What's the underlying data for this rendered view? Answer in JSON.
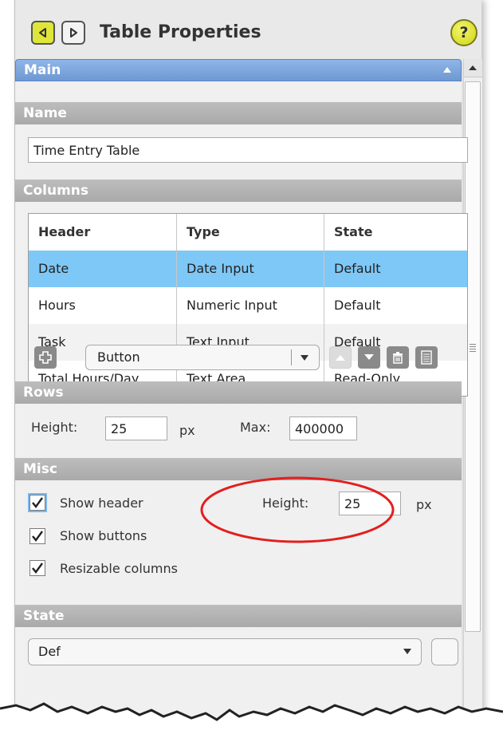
{
  "header": {
    "title": "Table Properties",
    "help_label": "?"
  },
  "main_section": {
    "label": "Main"
  },
  "name_section": {
    "label": "Name",
    "value": "Time Entry Table"
  },
  "columns_section": {
    "label": "Columns",
    "headers": [
      "Header",
      "Type",
      "State"
    ],
    "rows": [
      [
        "Date",
        "Date Input",
        "Default"
      ],
      [
        "Hours",
        "Numeric Input",
        "Default"
      ],
      [
        "Task",
        "Text Input",
        "Default"
      ],
      [
        "Total Hours/Day",
        "Text Area",
        "Read-Only"
      ]
    ],
    "selected_row": 0,
    "component_dropdown": "Button"
  },
  "rows_section": {
    "label": "Rows",
    "height_label": "Height:",
    "height_value": "25",
    "height_unit": "px",
    "max_label": "Max:",
    "max_value": "400000"
  },
  "misc_section": {
    "label": "Misc",
    "show_header_label": "Show header",
    "show_header": true,
    "header_height_label": "Height:",
    "header_height_value": "25",
    "header_height_unit": "px",
    "show_buttons_label": "Show buttons",
    "show_buttons": true,
    "resizable_columns_label": "Resizable columns",
    "resizable_columns": true
  },
  "state_section": {
    "label": "State",
    "dropdown_value": "Def"
  },
  "colors": {
    "main_bar": "#7aa3dc",
    "section_bar": "#b3b3b3",
    "selected_row": "#7ec8f7",
    "nav_back": "#dfe63a",
    "help": "#e1e531",
    "annotation": "#e21f1f"
  }
}
